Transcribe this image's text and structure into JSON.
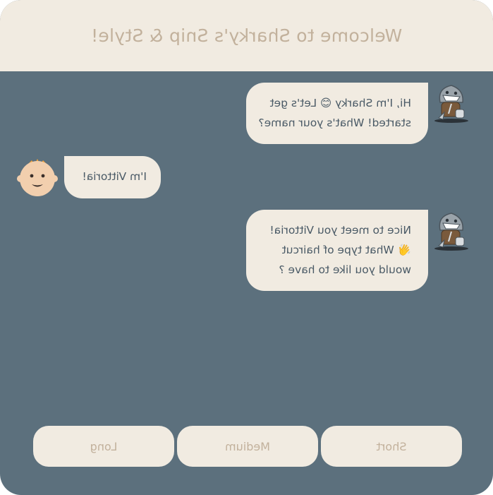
{
  "header": {
    "title": "Welcome to Sharky's Snip & Style!"
  },
  "messages": [
    {
      "sender": "bot",
      "lines": [
        "Hi, I'm Sharky 😊 Let's get",
        "started! What's your name?"
      ]
    },
    {
      "sender": "user",
      "lines": [
        "I'm Vittoria!"
      ]
    },
    {
      "sender": "bot",
      "lines": [
        "Nice to meet you Vittoria!",
        "👋 What type of haircut",
        "would you like to have ?"
      ]
    }
  ],
  "options": {
    "short": "Short",
    "medium": "Medium",
    "long": "Long"
  },
  "colors": {
    "chat_background": "#5c707d",
    "bubble": "#f1ebe1",
    "header_text": "#c2b19c",
    "message_text": "#4a5a66"
  },
  "icons": {
    "bot_avatar": "shark-barber-icon",
    "user_avatar": "smiling-face-icon"
  }
}
